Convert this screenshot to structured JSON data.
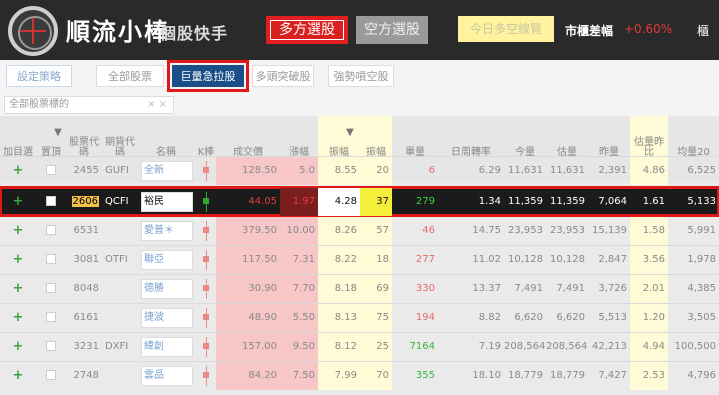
{
  "app": {
    "brand": "順流小棒",
    "subtitle": "個股快手"
  },
  "header": {
    "long_button": "多方選股",
    "short_button": "空方選股",
    "today_button": "今日多空線覽",
    "market_label": "市櫃差幅",
    "market_value": "+0.60%",
    "market_extra": "櫃"
  },
  "tabs": {
    "settings": "設定策略",
    "all": "全部股票",
    "active": "巨量急拉股",
    "long_break": "多頭突破股",
    "short_strong": "強勢噴空股"
  },
  "filter": {
    "placeholder": "全部股票標的",
    "clear": "× ×"
  },
  "columns": [
    "加目選",
    "置頂",
    "股票代碼",
    "期貨代碼",
    "名稱",
    "K棒",
    "成交價",
    "漲幅",
    "振幅",
    "振幅",
    "單量",
    "日周轉率",
    "今量",
    "估量",
    "昨量",
    "估量昨比",
    "均量20"
  ],
  "sort_indicators": {
    "top": "▼",
    "amp": "▼"
  },
  "rows": [
    {
      "code": "2455",
      "fut": "GUFI",
      "name": "全新",
      "price": "128.50",
      "chg": "5.0",
      "amp1": "8.55",
      "amp2": "20",
      "vol": "6",
      "turn": "6.29",
      "today": "11,631",
      "est": "11,631",
      "yday": "2,391",
      "ratio": "4.86",
      "avg20": "6,525"
    },
    {
      "code": "2606",
      "fut": "QCFI",
      "name": "裕民",
      "price": "44.05",
      "chg": "1.97",
      "amp1": "4.28",
      "amp2": "37",
      "vol": "279",
      "turn": "1.34",
      "today": "11,359",
      "est": "11,359",
      "yday": "7,064",
      "ratio": "1.61",
      "avg20": "5,133"
    },
    {
      "code": "6531",
      "fut": "",
      "name": "愛普＊",
      "price": "379.50",
      "chg": "10.00",
      "amp1": "8.26",
      "amp2": "57",
      "vol": "46",
      "turn": "14.75",
      "today": "23,953",
      "est": "23,953",
      "yday": "15,139",
      "ratio": "1.58",
      "avg20": "5,991"
    },
    {
      "code": "3081",
      "fut": "OTFI",
      "name": "聯亞",
      "price": "117.50",
      "chg": "7.31",
      "amp1": "8.22",
      "amp2": "18",
      "vol": "277",
      "turn": "11.02",
      "today": "10,128",
      "est": "10,128",
      "yday": "2,847",
      "ratio": "3.56",
      "avg20": "1,978"
    },
    {
      "code": "8048",
      "fut": "",
      "name": "德勝",
      "price": "30.90",
      "chg": "7.70",
      "amp1": "8.18",
      "amp2": "69",
      "vol": "330",
      "turn": "13.37",
      "today": "7,491",
      "est": "7,491",
      "yday": "3,726",
      "ratio": "2.01",
      "avg20": "4,385"
    },
    {
      "code": "6161",
      "fut": "",
      "name": "捷波",
      "price": "48.90",
      "chg": "5.50",
      "amp1": "8.13",
      "amp2": "75",
      "vol": "194",
      "turn": "8.82",
      "today": "6,620",
      "est": "6,620",
      "yday": "5,513",
      "ratio": "1.20",
      "avg20": "3,505"
    },
    {
      "code": "3231",
      "fut": "DXFI",
      "name": "緯創",
      "price": "157.00",
      "chg": "9.50",
      "amp1": "8.12",
      "amp2": "25",
      "vol": "7164",
      "turn": "7.19",
      "today": "208,564",
      "est": "208,564",
      "yday": "42,213",
      "ratio": "4.94",
      "avg20": "100,500"
    },
    {
      "code": "2748",
      "fut": "",
      "name": "雲品",
      "price": "84.20",
      "chg": "7.50",
      "amp1": "7.99",
      "amp2": "70",
      "vol": "355",
      "turn": "18.10",
      "today": "18,779",
      "est": "18,779",
      "yday": "7,427",
      "ratio": "2.53",
      "avg20": "4,796"
    }
  ],
  "row_plus": "+",
  "colors": {
    "accent_red": "#e01818",
    "active_tab": "#1a4e86",
    "selected_row": "#1b1b1b"
  }
}
